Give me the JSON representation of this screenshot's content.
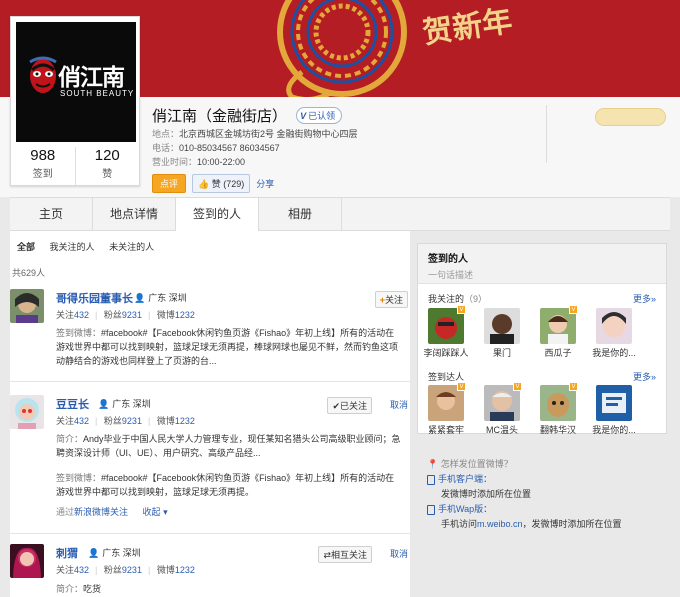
{
  "profile": {
    "name": "俏江南（金融街店）",
    "verified_label": "已认领",
    "address_label": "地点：",
    "address": "北京西城区金城坊街2号 金融街购物中心四层",
    "phone_label": "电话：",
    "phone": "010-85034567 86034567",
    "hours_label": "营业时间：",
    "hours": "10:00-22:00",
    "comment_button": "点评",
    "like_button": "赞 (729)",
    "share_link": "分享",
    "checkins_count": "988",
    "checkins_label": "签到",
    "likes_count": "120",
    "likes_label": "赞",
    "logo_text": "俏江南",
    "logo_text_en": "SOUTH BEAUTY"
  },
  "tabs": [
    "主页",
    "地点详情",
    "签到的人",
    "相册"
  ],
  "subtabs": [
    "全部",
    "我关注的人",
    "未关注的人"
  ],
  "checkin_count": "共629人",
  "feed": [
    {
      "name": "哥得乐园董事长",
      "location": "广东 深圳",
      "follow_count_label": "关注",
      "follow_count": "432",
      "fans_label": "粉丝",
      "fans": "9231",
      "weibo_label": "微博",
      "weibo": "1232",
      "button": "关注",
      "checkin_label": "签到微博：",
      "checkin_text": "#facebook#【Facebook休闲钓鱼页游《Fishao》年初上线】所有的活动在游戏世界中都可以找到映射，篮球足球无须再提，棒球网球也屡见不鲜，然而钓鱼这项动静结合的游戏也同样登上了页游的台..."
    },
    {
      "name": "豆豆长",
      "location": "广东 深圳",
      "follow_count_label": "关注",
      "follow_count": "432",
      "fans_label": "粉丝",
      "fans": "9231",
      "weibo_label": "微博",
      "weibo": "1232",
      "button": "已关注",
      "button2": "取消",
      "intro_label": "简介：",
      "intro": "Andy毕业于中国人民大学人力管理专业，现任某知名猎头公司高级职业顾问；急聘资深设计师（UI、UE）、用户研究、高级产品经...",
      "checkin_label": "签到微博：",
      "checkin_text": "#facebook#【Facebook休闲钓鱼页游《Fishao》年初上线】所有的活动在游戏世界中都可以找到映射，篮球足球无须再提。",
      "via": "通过",
      "via_link": "新浪微博关注",
      "collapse": "收起"
    },
    {
      "name": "刺猬",
      "location": "广东 深圳",
      "follow_count_label": "关注",
      "follow_count": "432",
      "fans_label": "粉丝",
      "fans": "9231",
      "weibo_label": "微博",
      "weibo": "1232",
      "button": "相互关注",
      "button2": "取消",
      "intro_label": "简介：",
      "intro": "吃货"
    }
  ],
  "sidebar": {
    "title": "签到的人",
    "subtitle": "一句话描述",
    "followed_title": "我关注的",
    "followed_count": "（9）",
    "more": "更多»",
    "followed": [
      "李阔踩踩人",
      "果门",
      "西瓜子",
      "我是你的..."
    ],
    "experts_title": "签到达人",
    "experts": [
      "紧紧套牢",
      "MC温头",
      "翻韩华汉",
      "我是你的..."
    ],
    "help_q": "怎样发位置微博？",
    "client_title": "手机客户端：",
    "client_desc": "发微博时添加所在位置",
    "wap_title": "手机Wap版：",
    "wap_desc_pre": "手机访问",
    "wap_link": "m.weibo.cn",
    "wap_desc_post": "，发微博时添加所在位置"
  },
  "banner_text": "贺新年",
  "colors": {
    "banner": "#b41d24",
    "link": "#2a5db0",
    "accent": "#f5a623"
  }
}
